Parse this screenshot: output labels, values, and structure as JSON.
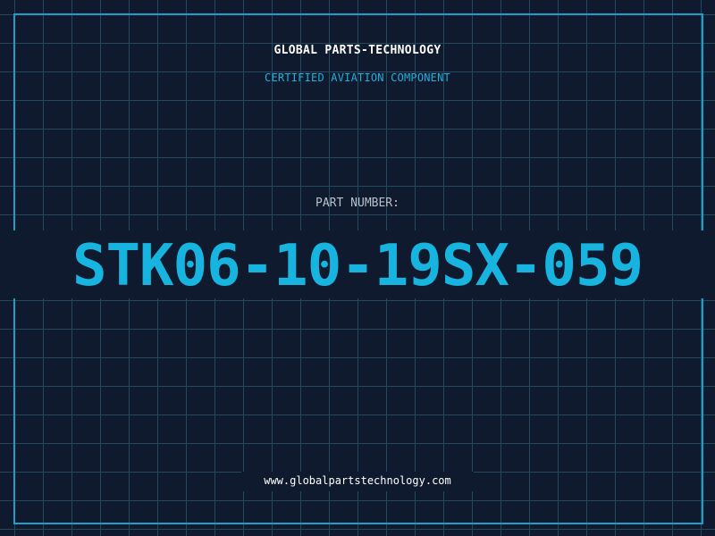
{
  "header": {
    "brand": "GLOBAL PARTS-TECHNOLOGY",
    "subtitle": "CERTIFIED AVIATION COMPONENT"
  },
  "part": {
    "label": "PART NUMBER:",
    "number": "STK06-10-19SX-059"
  },
  "footer": {
    "url": "www.globalpartstechnology.com"
  },
  "colors": {
    "background": "#101a2e",
    "grid": "#1f4a60",
    "frame": "#1e9ec4",
    "accent": "#18b4e0",
    "text": "#ffffff",
    "muted": "#b8c0cc"
  }
}
